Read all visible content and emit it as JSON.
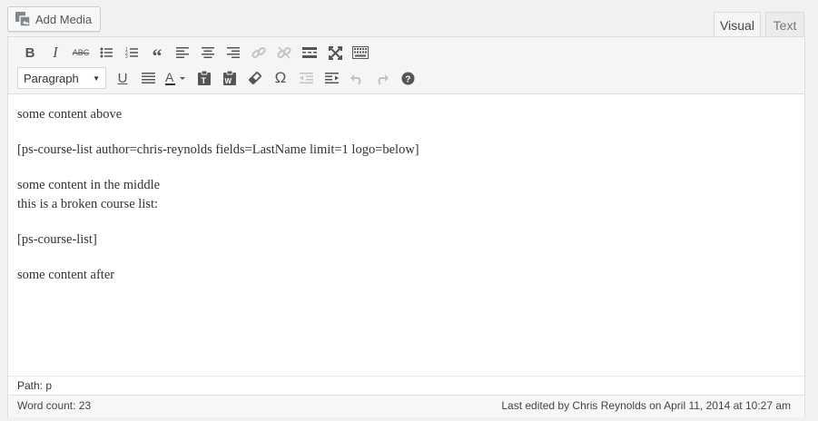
{
  "add_media": {
    "label": "Add Media",
    "icon": "media-icon"
  },
  "tabs": [
    {
      "label": "Visual",
      "active": true
    },
    {
      "label": "Text",
      "active": false
    }
  ],
  "toolbar": {
    "row1": [
      "bold-icon",
      "italic-icon",
      "strikethrough-icon",
      "bullet-list-icon",
      "numbered-list-icon",
      "blockquote-icon",
      "align-left-icon",
      "align-center-icon",
      "align-right-icon",
      "link-icon",
      "unlink-icon",
      "read-more-icon",
      "fullscreen-icon",
      "toolbar-toggle-icon"
    ],
    "format_select": {
      "value": "Paragraph"
    },
    "row2": [
      "underline-icon",
      "justify-icon",
      "text-color-icon",
      "paste-text-icon",
      "paste-word-icon",
      "clear-formatting-icon",
      "special-character-icon",
      "outdent-icon",
      "indent-icon",
      "undo-icon",
      "redo-icon",
      "help-icon"
    ]
  },
  "content": {
    "p1": "some content above",
    "p2": "[ps-course-list author=chris-reynolds fields=LastName limit=1 logo=below]",
    "p3_line1": "some content in the middle",
    "p3_line2": "this is a broken course list:",
    "p4": "[ps-course-list]",
    "p5": "some content after"
  },
  "path": "Path: p",
  "status": {
    "word_count": "Word count: 23",
    "last_edited": "Last edited by Chris Reynolds on April 11, 2014 at 10:27 am"
  },
  "colors": {
    "accent": "#555555",
    "disabled": "#c3c3c3",
    "background": "#f1f1f1"
  }
}
